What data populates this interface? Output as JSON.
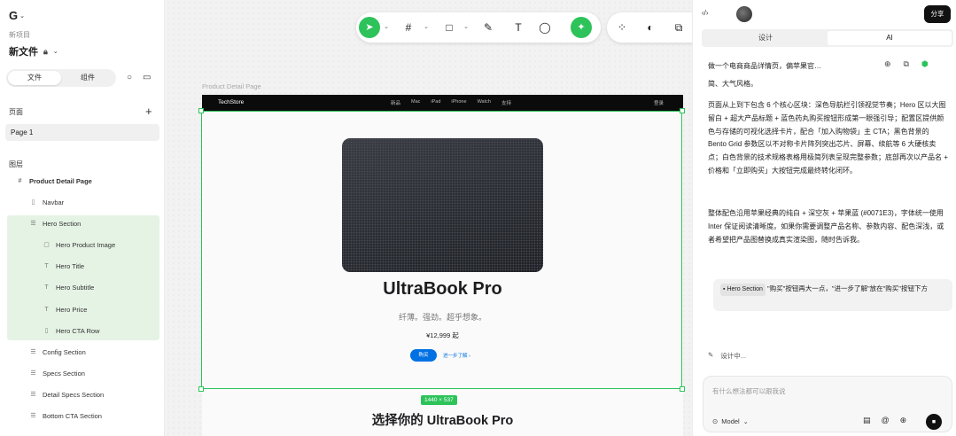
{
  "left": {
    "logo": "G",
    "project": "新项目",
    "filename": "新文件",
    "tabs": [
      "文件",
      "组件"
    ],
    "pages_title": "页面",
    "page_item": "Page 1",
    "layers_title": "图层",
    "layers": [
      {
        "label": "Product Detail Page",
        "icon": "#"
      },
      {
        "label": "Navbar",
        "icon": "▯"
      },
      {
        "label": "Hero Section",
        "icon": "☰"
      },
      {
        "label": "Hero Product Image",
        "icon": "▢"
      },
      {
        "label": "Hero Title",
        "icon": "T"
      },
      {
        "label": "Hero Subtitle",
        "icon": "T"
      },
      {
        "label": "Hero Price",
        "icon": "T"
      },
      {
        "label": "Hero CTA Row",
        "icon": "▯"
      },
      {
        "label": "Config Section",
        "icon": "☰"
      },
      {
        "label": "Specs Section",
        "icon": "☰"
      },
      {
        "label": "Detail Specs Section",
        "icon": "☰"
      },
      {
        "label": "Bottom CTA Section",
        "icon": "☰"
      }
    ]
  },
  "canvas": {
    "frame_label": "Product Detail Page",
    "nav": {
      "brand": "TechStore",
      "links": [
        "新品",
        "Mac",
        "iPad",
        "iPhone",
        "Watch",
        "支持"
      ],
      "right": "登录"
    },
    "hero": {
      "title": "UltraBook Pro",
      "subtitle": "纤薄。强劲。超乎想象。",
      "price": "¥12,999 起",
      "buy": "购买",
      "more": "进一步了解 ›"
    },
    "section2_title": "选择你的 UltraBook Pro",
    "dimensions": "1440 × 537"
  },
  "right": {
    "code_icon": "‹/›",
    "share": "分享",
    "tabs": [
      "设计",
      "AI"
    ],
    "chat_title": "做一个电商商品详情页，偏苹果官…",
    "para1": "简、大气风格。",
    "para2": "页面从上到下包含 6 个核心区块：深色导航栏引领视觉节奏；Hero 区以大图留白 + 超大产品标题 + 蓝色药丸购买按钮形成第一眼强引导；配置区提供颜色与存储的可视化选择卡片，配合「加入购物袋」主 CTA；黑色背景的 Bento Grid 参数区以不对称卡片阵列突出芯片、屏幕、续航等 6 大硬核卖点；白色背景的技术规格表格用极简列表呈现完整参数；底部再次以产品名 + 价格和「立即购买」大按钮完成最终转化闭环。",
    "para3": "整体配色沿用苹果经典的纯白 + 深空灰 + 苹果蓝 (#0071E3)，字体统一使用 Inter 保证阅读清晰度。如果你需要调整产品名称、参数内容、配色深浅，或者希望把产品图替换成真实渲染图，随时告诉我。",
    "user_chip": "Hero Section",
    "user_msg": "\"购买\"按钮再大一点，\"进一步了解\"放在\"购买\"按钮下方",
    "status": "设计中...",
    "input_placeholder": "有什么想法都可以跟我说",
    "model": "Model"
  },
  "colors": {
    "accent": "#2dc35a",
    "apple_blue": "#0071e3",
    "nav_bg": "#0b0b0b"
  }
}
